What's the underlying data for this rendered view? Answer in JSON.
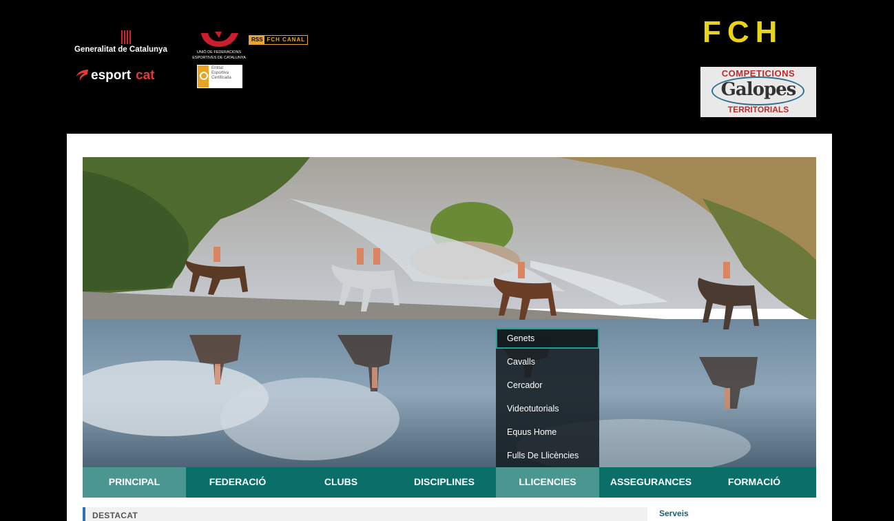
{
  "header": {
    "generalitat": "Generalitat de Catalunya",
    "esportcat": {
      "part1": "esport",
      "part2": "cat"
    },
    "ufec": {
      "line1": "UNIÓ DE FEDERACIONS",
      "line2": "ESPORTIVES DE CATALUNYA"
    },
    "rss_badge": {
      "rss": "RSS",
      "label": "FCH CANAL"
    },
    "certified": {
      "line1": "Entitat",
      "line2": "Esportiva",
      "line3": "Certificada"
    },
    "fch": "FCH",
    "competicions": {
      "top": "COMPETICIONS",
      "middle": "Galopes",
      "bottom": "TERRITORIALS"
    }
  },
  "nav": {
    "tabs": [
      {
        "label": "PRINCIPAL"
      },
      {
        "label": "FEDERACIÓ"
      },
      {
        "label": "CLUBS"
      },
      {
        "label": "DISCIPLINES"
      },
      {
        "label": "LLICENCIES"
      },
      {
        "label": "ASSEGURANCES"
      },
      {
        "label": "FORMACIÓ"
      }
    ],
    "open_tab": "LLICENCIES"
  },
  "dropdown": {
    "items": [
      {
        "label": "Genets"
      },
      {
        "label": "Cavalls"
      },
      {
        "label": "Cercador"
      },
      {
        "label": "Videotutorials"
      },
      {
        "label": "Equus Home"
      },
      {
        "label": "Fulls De Llicències"
      }
    ],
    "active": "Genets"
  },
  "sections": {
    "destacat": "DESTACAT",
    "serveis": "Serveis"
  },
  "colors": {
    "nav_bg": "#0a6e69",
    "nav_active": "#4c9691",
    "fch_yellow": "#e8d51a",
    "accent_red": "#d5202f"
  }
}
